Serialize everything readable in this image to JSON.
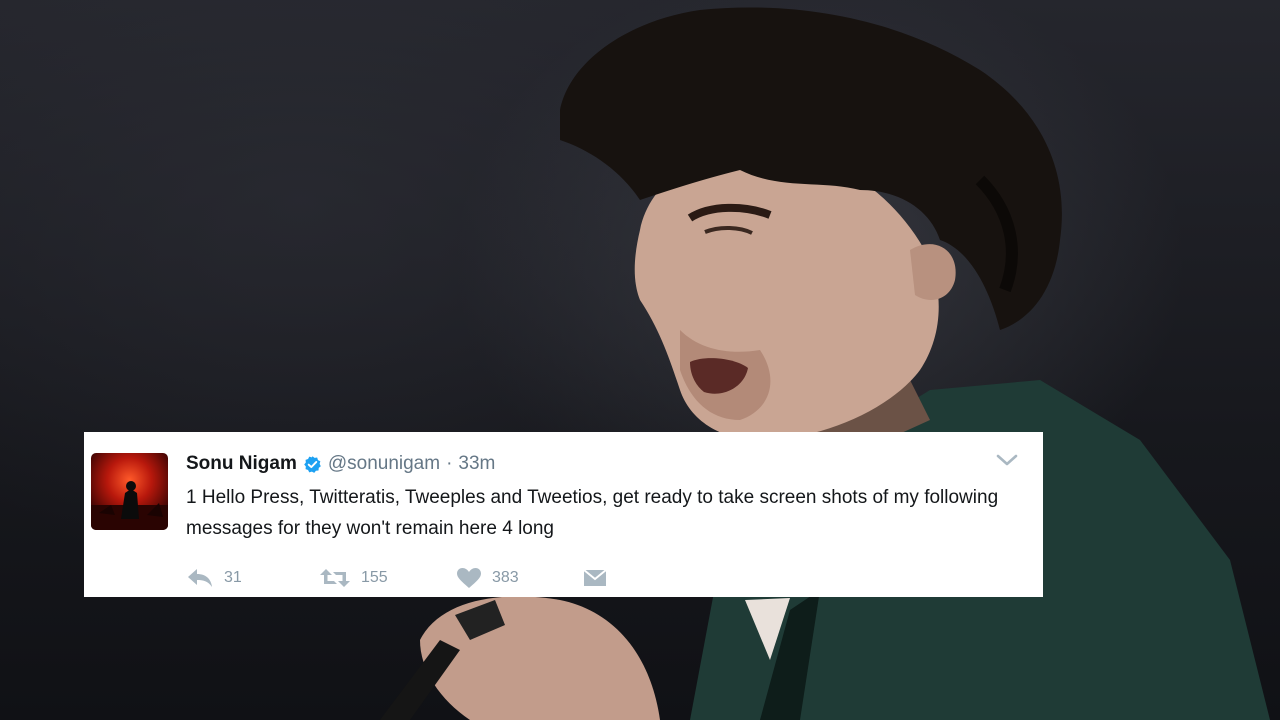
{
  "tweet": {
    "author_name": "Sonu Nigam",
    "handle": "@sonunigam",
    "separator": "·",
    "timestamp": "33m",
    "text": "1 Hello Press, Twitteratis, Tweeples and Tweetios, get ready to take screen shots of my following messages for they won't remain here 4 long",
    "replies": "31",
    "retweets": "155",
    "likes": "383"
  },
  "icons": {
    "verified": "verified-badge-icon",
    "caret": "chevron-down-icon",
    "reply": "reply-icon",
    "retweet": "retweet-icon",
    "like": "heart-icon",
    "dm": "direct-message-icon"
  },
  "colors": {
    "verified": "#1da1f2",
    "action_gray": "#aab8c2",
    "muted_text": "#657786"
  }
}
